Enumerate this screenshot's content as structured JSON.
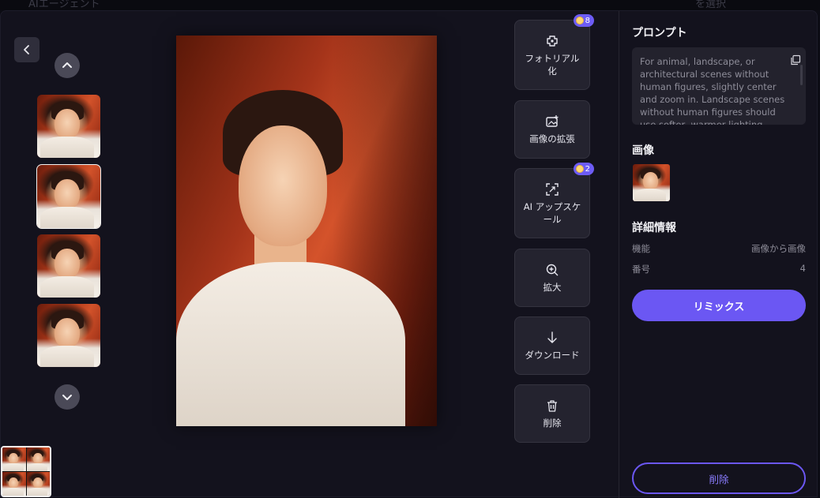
{
  "topbar": {
    "left_text": "AIエージェント",
    "right_text": "を選択"
  },
  "navigation": {
    "back_icon": "chevron-left-icon",
    "up_icon": "chevron-up-icon",
    "down_icon": "chevron-down-icon"
  },
  "thumbnails": [
    {
      "selected": false
    },
    {
      "selected": true
    },
    {
      "selected": false
    },
    {
      "selected": false
    }
  ],
  "tools": [
    {
      "icon": "photorealistic-icon",
      "label": "フォトリアル化",
      "badge": "8"
    },
    {
      "icon": "image-expand-icon",
      "label": "画像の拡張",
      "badge": ""
    },
    {
      "icon": "upscale-icon",
      "label": "AI アップスケール",
      "badge": "2"
    },
    {
      "icon": "zoom-in-icon",
      "label": "拡大",
      "badge": ""
    },
    {
      "icon": "download-icon",
      "label": "ダウンロード",
      "badge": ""
    },
    {
      "icon": "trash-icon",
      "label": "削除",
      "badge": ""
    }
  ],
  "sidebar": {
    "prompt_heading": "プロンプト",
    "prompt_text": "For animal, landscape, or architectural scenes without human figures, slightly center and zoom in. Landscape scenes without human figures should use softer, warmer lighting, while night scenes",
    "image_heading": "画像",
    "details_heading": "詳細情報",
    "details": [
      {
        "key": "機能",
        "value": "画像から画像"
      },
      {
        "key": "番号",
        "value": "4"
      }
    ],
    "remix_label": "リミックス",
    "delete_label": "削除"
  },
  "colors": {
    "accent": "#6b57f3",
    "background": "#13121d",
    "tool_bg": "#24232f"
  }
}
